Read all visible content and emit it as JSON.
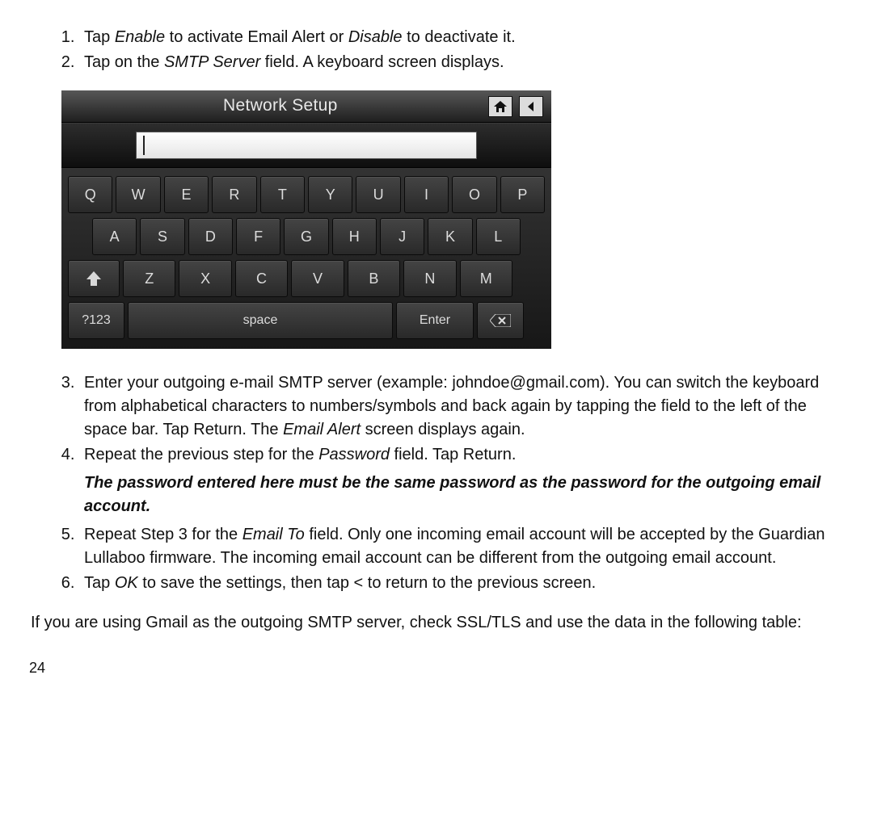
{
  "steps_top": [
    {
      "pre": "Tap ",
      "em1": "Enable",
      "mid": " to activate Email Alert or ",
      "em2": "Disable",
      "post": " to deactivate it."
    },
    {
      "pre": "Tap on the ",
      "em1": "SMTP Server",
      "mid": " field. A keyboard screen displays.",
      "em2": "",
      "post": ""
    }
  ],
  "screen": {
    "title": "Network Setup",
    "input_value": "",
    "row1": [
      "Q",
      "W",
      "E",
      "R",
      "T",
      "Y",
      "U",
      "I",
      "O",
      "P"
    ],
    "row2": [
      "A",
      "S",
      "D",
      "F",
      "G",
      "H",
      "J",
      "K",
      "L"
    ],
    "row3": [
      "Z",
      "X",
      "C",
      "V",
      "B",
      "N",
      "M"
    ],
    "num_label": "?123",
    "space_label": "space",
    "enter_label": "Enter"
  },
  "steps_bottom": [
    {
      "n": 3,
      "segments": [
        {
          "t": "Enter your outgoing e-mail SMTP server (example: johndoe@gmail.com). You can switch the keyboard from alphabetical characters to numbers/symbols and back again by tapping the field to the left of the space bar. Tap Return. The "
        },
        {
          "em": "Email Alert"
        },
        {
          "t": " screen displays again."
        }
      ]
    },
    {
      "n": 4,
      "segments": [
        {
          "t": "Repeat the previous step for the "
        },
        {
          "em": "Password"
        },
        {
          "t": " field. Tap Return."
        }
      ],
      "note": "The password entered here must be the same password as the password for the outgoing email account."
    },
    {
      "n": 5,
      "segments": [
        {
          "t": "Repeat Step 3 for the "
        },
        {
          "em": "Email To"
        },
        {
          "t": " field. Only one incoming email account will be accepted by the Guardian Lullaboo firmware. The incoming email account can be different from the outgoing email account."
        }
      ]
    },
    {
      "n": 6,
      "segments": [
        {
          "t": "Tap "
        },
        {
          "em": "OK"
        },
        {
          "t": " to save the settings, then tap < to return to the previous screen."
        }
      ]
    }
  ],
  "closing": "If you are using Gmail as the outgoing SMTP server, check SSL/TLS and use the data in the following table:",
  "page_number": "24"
}
